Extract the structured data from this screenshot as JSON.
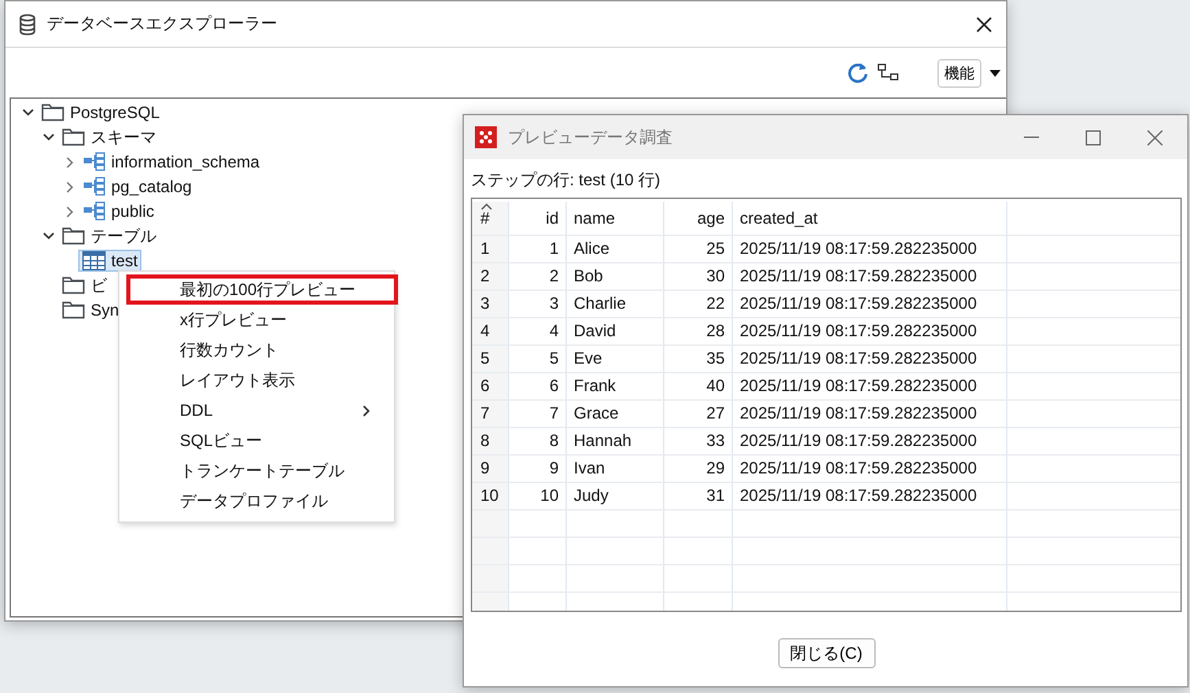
{
  "explorer": {
    "title": "データベースエクスプローラー",
    "function_button": "機能",
    "tree": [
      {
        "label": "PostgreSQL",
        "kind": "folder",
        "expanded": true,
        "selected": false,
        "children": [
          {
            "label": "スキーマ",
            "kind": "folder",
            "expanded": true,
            "selected": false,
            "children": [
              {
                "label": "information_schema",
                "kind": "schema",
                "expanded": false,
                "selected": false
              },
              {
                "label": "pg_catalog",
                "kind": "schema",
                "expanded": false,
                "selected": false
              },
              {
                "label": "public",
                "kind": "schema",
                "expanded": false,
                "selected": false
              }
            ]
          },
          {
            "label": "テーブル",
            "kind": "folder",
            "expanded": true,
            "selected": false,
            "children": [
              {
                "label": "test",
                "kind": "table",
                "selected": true
              }
            ]
          },
          {
            "label": "ビ",
            "kind": "folder",
            "selected": false
          },
          {
            "label": "Syn",
            "kind": "folder",
            "selected": false
          }
        ]
      }
    ]
  },
  "context_menu": [
    {
      "label": "最初の100行プレビュー",
      "highlighted": true,
      "kind": "item"
    },
    {
      "label": "x行プレビュー",
      "highlighted": false,
      "kind": "item"
    },
    {
      "label": "行数カウント",
      "highlighted": false,
      "kind": "item"
    },
    {
      "label": "レイアウト表示",
      "highlighted": false,
      "kind": "item"
    },
    {
      "label": "DDL",
      "highlighted": false,
      "kind": "submenu"
    },
    {
      "label": "SQLビュー",
      "highlighted": false,
      "kind": "item"
    },
    {
      "label": "トランケートテーブル",
      "highlighted": false,
      "kind": "item"
    },
    {
      "label": "データプロファイル",
      "highlighted": false,
      "kind": "item"
    }
  ],
  "preview": {
    "title": "プレビューデータ調査",
    "caption": "ステップの行: test (10 行)",
    "columns": [
      "#",
      "id",
      "name",
      "age",
      "created_at"
    ],
    "rows": [
      [
        "1",
        "1",
        "Alice",
        "25",
        "2025/11/19 08:17:59.282235000"
      ],
      [
        "2",
        "2",
        "Bob",
        "30",
        "2025/11/19 08:17:59.282235000"
      ],
      [
        "3",
        "3",
        "Charlie",
        "22",
        "2025/11/19 08:17:59.282235000"
      ],
      [
        "4",
        "4",
        "David",
        "28",
        "2025/11/19 08:17:59.282235000"
      ],
      [
        "5",
        "5",
        "Eve",
        "35",
        "2025/11/19 08:17:59.282235000"
      ],
      [
        "6",
        "6",
        "Frank",
        "40",
        "2025/11/19 08:17:59.282235000"
      ],
      [
        "7",
        "7",
        "Grace",
        "27",
        "2025/11/19 08:17:59.282235000"
      ],
      [
        "8",
        "8",
        "Hannah",
        "33",
        "2025/11/19 08:17:59.282235000"
      ],
      [
        "9",
        "9",
        "Ivan",
        "29",
        "2025/11/19 08:17:59.282235000"
      ],
      [
        "10",
        "10",
        "Judy",
        "31",
        "2025/11/19 08:17:59.282235000"
      ]
    ],
    "close_button": "閉じる(C)"
  }
}
